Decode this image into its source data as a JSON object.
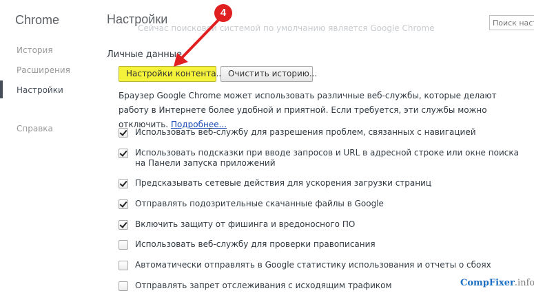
{
  "sidebar": {
    "brand": "Chrome",
    "items": [
      {
        "label": "История"
      },
      {
        "label": "Расширения"
      },
      {
        "label": "Настройки"
      },
      {
        "label": "Справка"
      }
    ]
  },
  "header": {
    "title": "Настройки",
    "ghost_text": "Сейчас поисковой системой по умолчанию является Google Chrome",
    "search_placeholder": "Поиск настр"
  },
  "privacy": {
    "title": "Личные данные",
    "content_settings_button": "Настройки контента...",
    "clear_history_button": "Очистить историю...",
    "description": "Браузер Google Chrome может использовать различные веб-службы, которые делают работу в Интернете более удобной и приятной. Если требуется, эти службы можно отключить.",
    "learn_more": "Подробнее...",
    "options": [
      {
        "label": "Использовать веб-службу для разрешения проблем, связанных с навигацией",
        "checked": true
      },
      {
        "label": "Использовать подсказки при вводе запросов и URL в адресной строке или окне поиска на Панели запуска приложений",
        "checked": true
      },
      {
        "label": "Предсказывать сетевые действия для ускорения загрузки страниц",
        "checked": true
      },
      {
        "label": "Отправлять подозрительные скачанные файлы в Google",
        "checked": true
      },
      {
        "label": "Включить защиту от фишинга и вредоносного ПО",
        "checked": true
      },
      {
        "label": "Использовать веб-службу для проверки правописания",
        "checked": false
      },
      {
        "label": "Автоматически отправлять в Google статистику использования и отчеты о сбоях",
        "checked": false
      },
      {
        "label": "Отправлять запрет отслеживания с исходящим трафиком",
        "checked": false
      }
    ]
  },
  "annotation": {
    "step_number": "4",
    "color": "#e02020"
  },
  "watermark": {
    "part1": "CompFixer",
    "part2": ".info"
  }
}
